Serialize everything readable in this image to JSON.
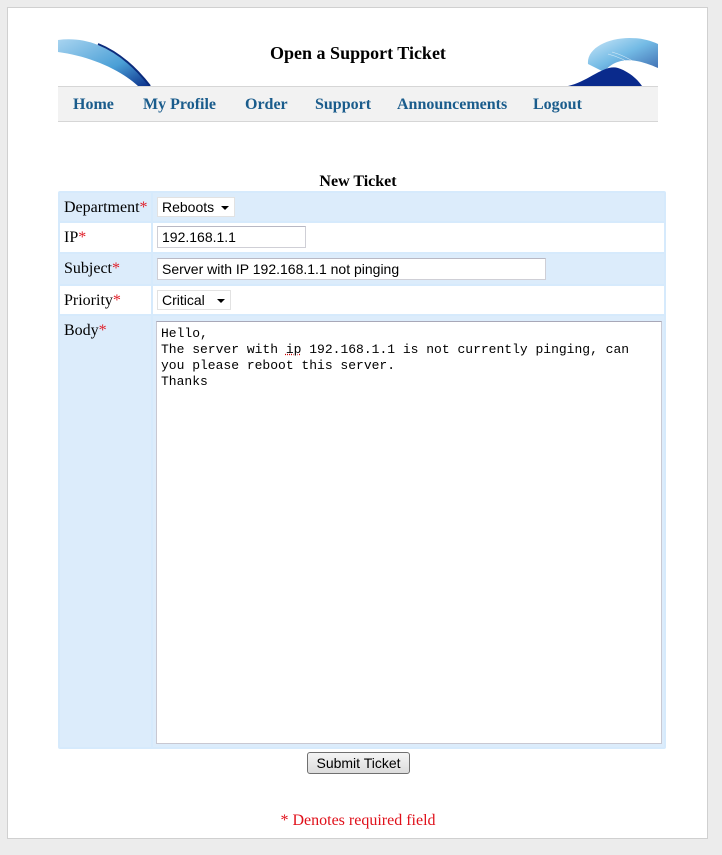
{
  "header": {
    "title": "Open a Support Ticket"
  },
  "nav": {
    "items": [
      {
        "label": "Home"
      },
      {
        "label": "My Profile"
      },
      {
        "label": "Order"
      },
      {
        "label": "Support"
      },
      {
        "label": "Announcements"
      },
      {
        "label": "Logout"
      }
    ]
  },
  "form": {
    "title": "New Ticket",
    "required_marker": "*",
    "department": {
      "label": "Department",
      "value": "Reboots"
    },
    "ip": {
      "label": "IP",
      "value": "192.168.1.1"
    },
    "subject": {
      "label": "Subject",
      "value": "Server with IP 192.168.1.1 not pinging"
    },
    "priority": {
      "label": "Priority",
      "value": "Critical"
    },
    "body": {
      "label": "Body",
      "line1": "Hello,",
      "line2_pre": "The server with ",
      "line2_spell": "ip",
      "line2_post": " 192.168.1.1 is not currently pinging, can",
      "line3": "you please reboot this server.",
      "line4": "Thanks"
    },
    "submit_label": "Submit Ticket",
    "footnote": "* Denotes required field"
  },
  "colors": {
    "nav_link": "#1a5c8c",
    "row_blue": "#dcecfb",
    "required": "#e0202a"
  }
}
